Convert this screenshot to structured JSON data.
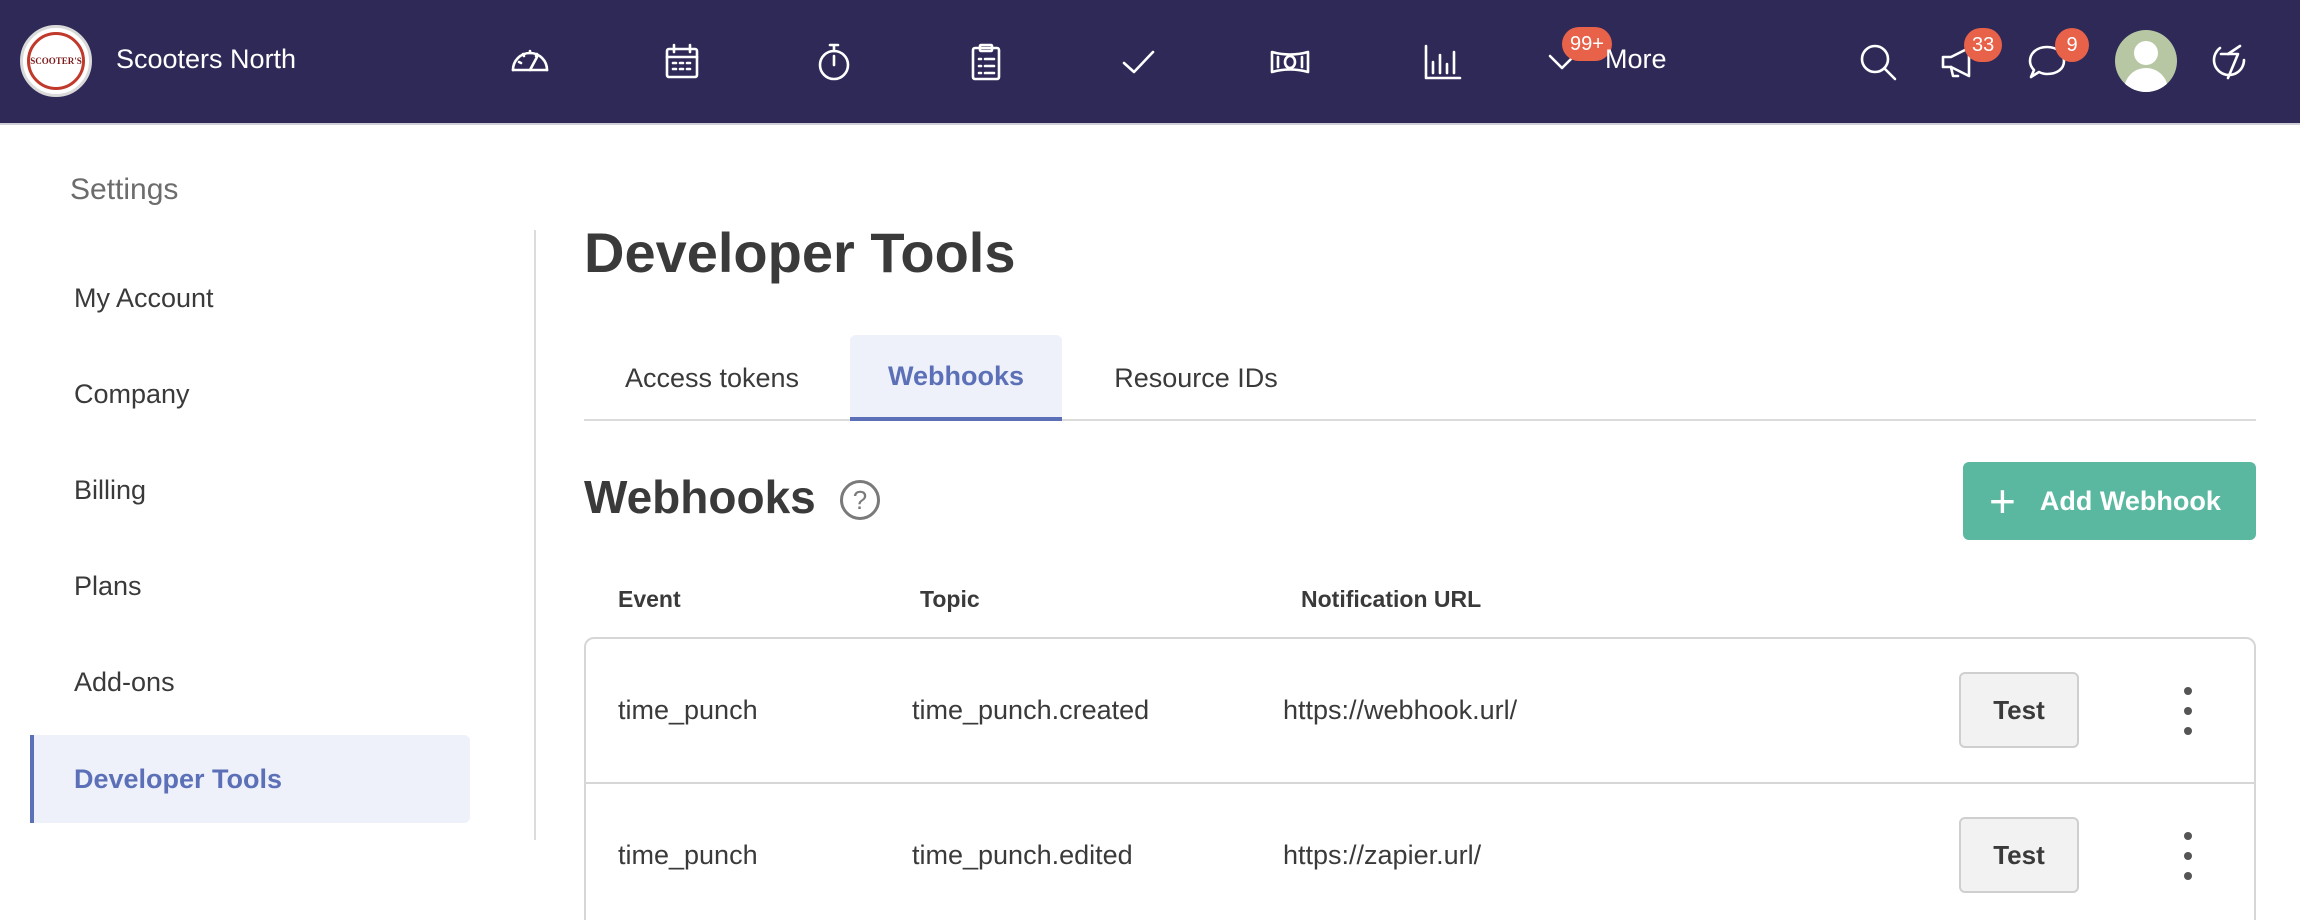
{
  "app": {
    "company_name": "Scooters North",
    "logo_text": "SCOOTER'S"
  },
  "topnav": {
    "icons": [
      "dashboard-icon",
      "calendar-icon",
      "stopwatch-icon",
      "clipboard-icon",
      "checkmark-icon",
      "money-icon",
      "bar-chart-icon"
    ],
    "more_label": "More",
    "more_badge": "99+",
    "announcements_badge": "33",
    "messages_badge": "9"
  },
  "sidebar": {
    "title": "Settings",
    "items": [
      {
        "label": "My Account",
        "active": false
      },
      {
        "label": "Company",
        "active": false
      },
      {
        "label": "Billing",
        "active": false
      },
      {
        "label": "Plans",
        "active": false
      },
      {
        "label": "Add-ons",
        "active": false
      },
      {
        "label": "Developer Tools",
        "active": true
      }
    ]
  },
  "main": {
    "title": "Developer Tools",
    "tabs": [
      {
        "label": "Access tokens",
        "active": false
      },
      {
        "label": "Webhooks",
        "active": true
      },
      {
        "label": "Resource IDs",
        "active": false
      }
    ],
    "section_title": "Webhooks",
    "help_symbol": "?",
    "add_button_label": "Add Webhook",
    "add_button_symbol": "+",
    "columns": [
      "Event",
      "Topic",
      "Notification URL"
    ],
    "rows": [
      {
        "event": "time_punch",
        "topic": "time_punch.created",
        "url": "https://webhook.url/",
        "test_label": "Test"
      },
      {
        "event": "time_punch",
        "topic": "time_punch.edited",
        "url": "https://zapier.url/",
        "test_label": "Test"
      }
    ]
  },
  "colors": {
    "topbar": "#2f2957",
    "accent": "#5c70b8",
    "add_button": "#5bb8a0",
    "badge": "#e8624a"
  }
}
